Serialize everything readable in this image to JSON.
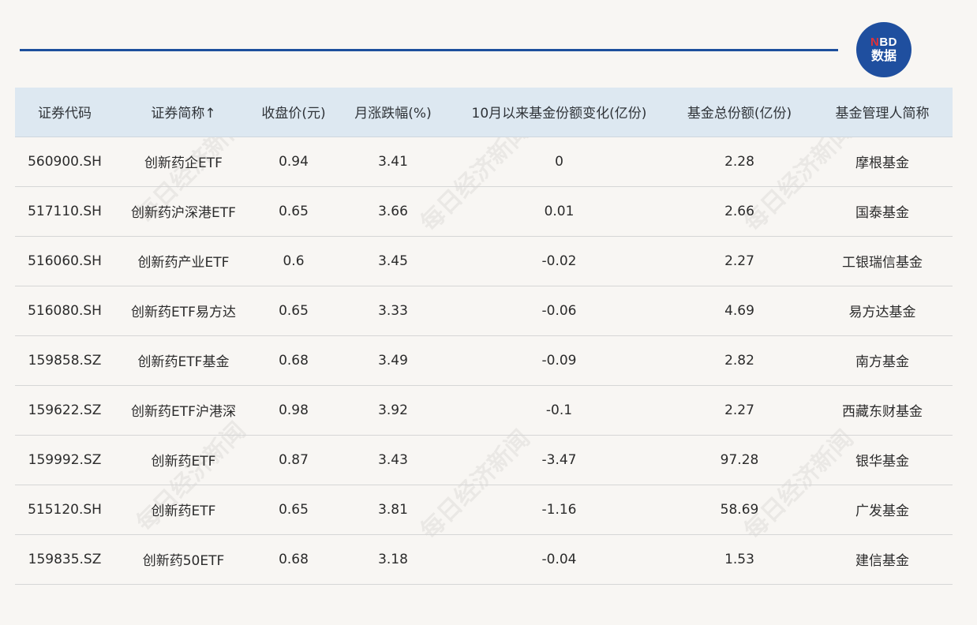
{
  "brand": {
    "logo_line1_n": "N",
    "logo_line1_rest": "BD",
    "logo_line2": "数据"
  },
  "watermark_text": "每日经济新闻",
  "table": {
    "headers": [
      "证券代码",
      "证券简称↑",
      "收盘价(元)",
      "月涨跌幅(%)",
      "10月以来基金份额变化(亿份)",
      "基金总份额(亿份)",
      "基金管理人简称"
    ],
    "rows": [
      [
        "560900.SH",
        "创新药企ETF",
        "0.94",
        "3.41",
        "0",
        "2.28",
        "摩根基金"
      ],
      [
        "517110.SH",
        "创新药沪深港ETF",
        "0.65",
        "3.66",
        "0.01",
        "2.66",
        "国泰基金"
      ],
      [
        "516060.SH",
        "创新药产业ETF",
        "0.6",
        "3.45",
        "-0.02",
        "2.27",
        "工银瑞信基金"
      ],
      [
        "516080.SH",
        "创新药ETF易方达",
        "0.65",
        "3.33",
        "-0.06",
        "4.69",
        "易方达基金"
      ],
      [
        "159858.SZ",
        "创新药ETF基金",
        "0.68",
        "3.49",
        "-0.09",
        "2.82",
        "南方基金"
      ],
      [
        "159622.SZ",
        "创新药ETF沪港深",
        "0.98",
        "3.92",
        "-0.1",
        "2.27",
        "西藏东财基金"
      ],
      [
        "159992.SZ",
        "创新药ETF",
        "0.87",
        "3.43",
        "-3.47",
        "97.28",
        "银华基金"
      ],
      [
        "515120.SH",
        "创新药ETF",
        "0.65",
        "3.81",
        "-1.16",
        "58.69",
        "广发基金"
      ],
      [
        "159835.SZ",
        "创新药50ETF",
        "0.68",
        "3.18",
        "-0.04",
        "1.53",
        "建信基金"
      ]
    ]
  },
  "colors": {
    "accent": "#1d4f9c",
    "header_bg": "#dde8f1",
    "page_bg": "#f8f6f3",
    "logo_red": "#e0323a"
  }
}
